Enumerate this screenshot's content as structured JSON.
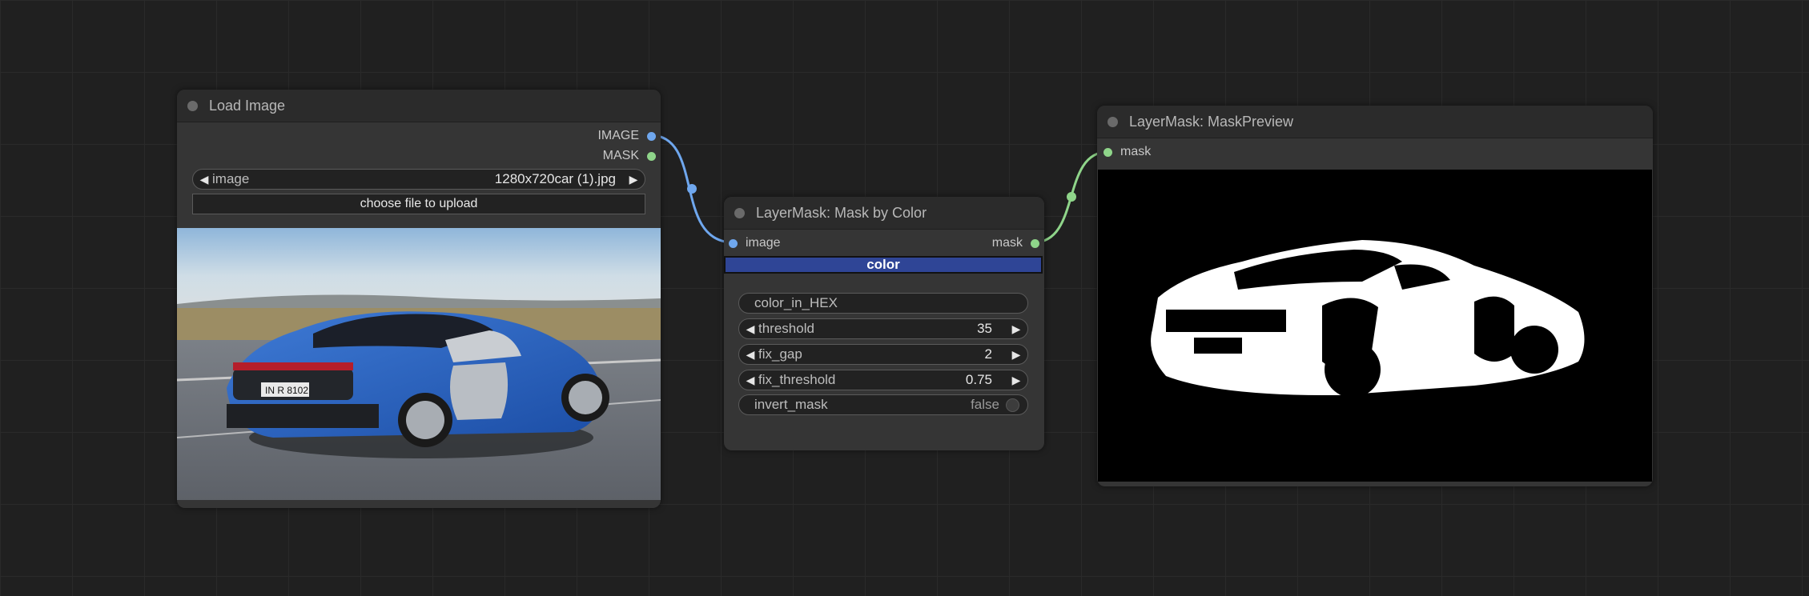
{
  "nodes": {
    "load_image": {
      "title": "Load Image",
      "outputs": {
        "image": "IMAGE",
        "mask": "MASK"
      },
      "image_widget": {
        "label": "image",
        "value": "1280x720car (1).jpg"
      },
      "upload_label": "choose file to upload"
    },
    "mask_by_color": {
      "title": "LayerMask: Mask by Color",
      "input_label": "image",
      "output_label": "mask",
      "color_label": "color",
      "color_hex": "#2f4596",
      "widgets": {
        "color_in_hex": {
          "label": "color_in_HEX"
        },
        "threshold": {
          "label": "threshold",
          "value": "35"
        },
        "fix_gap": {
          "label": "fix_gap",
          "value": "2"
        },
        "fix_threshold": {
          "label": "fix_threshold",
          "value": "0.75"
        },
        "invert_mask": {
          "label": "invert_mask",
          "value": "false"
        }
      }
    },
    "mask_preview": {
      "title": "LayerMask: MaskPreview",
      "input_label": "mask"
    }
  },
  "colors": {
    "image_link": "#6fa7ee",
    "mask_link": "#8fd58a",
    "canvas_bg": "#202020",
    "node_bg": "#353535"
  },
  "icons": {
    "collapse": "circle-dot-icon",
    "decrement": "arrow-left-icon",
    "increment": "arrow-right-icon"
  }
}
